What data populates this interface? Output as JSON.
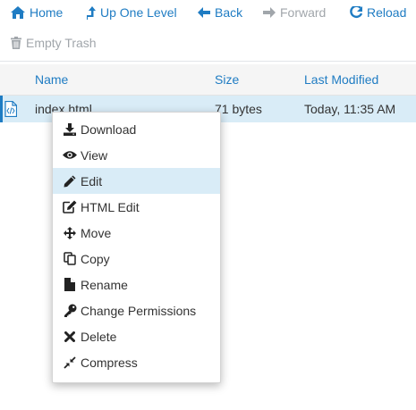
{
  "toolbar": {
    "home": "Home",
    "up_one_level": "Up One Level",
    "back": "Back",
    "forward": "Forward",
    "reload": "Reload",
    "empty_trash": "Empty Trash"
  },
  "table": {
    "columns": {
      "name": "Name",
      "size": "Size",
      "last_modified": "Last Modified"
    },
    "rows": [
      {
        "name": "index.html",
        "size": "71 bytes",
        "last_modified": "Today, 11:35 AM",
        "icon": "html-file-icon"
      }
    ]
  },
  "context_menu": {
    "items": [
      {
        "label": "Download",
        "icon": "download-icon"
      },
      {
        "label": "View",
        "icon": "eye-icon"
      },
      {
        "label": "Edit",
        "icon": "pencil-icon",
        "highlighted": true
      },
      {
        "label": "HTML Edit",
        "icon": "edit-square-icon"
      },
      {
        "label": "Move",
        "icon": "move-arrows-icon"
      },
      {
        "label": "Copy",
        "icon": "copy-icon"
      },
      {
        "label": "Rename",
        "icon": "file-icon"
      },
      {
        "label": "Change Permissions",
        "icon": "key-icon"
      },
      {
        "label": "Delete",
        "icon": "x-icon"
      },
      {
        "label": "Compress",
        "icon": "compress-icon"
      }
    ]
  },
  "colors": {
    "link": "#1f7cc3",
    "disabled": "#a1a6ab",
    "selected_row": "#d9ecf7",
    "header_bg": "#f5f5f5"
  }
}
